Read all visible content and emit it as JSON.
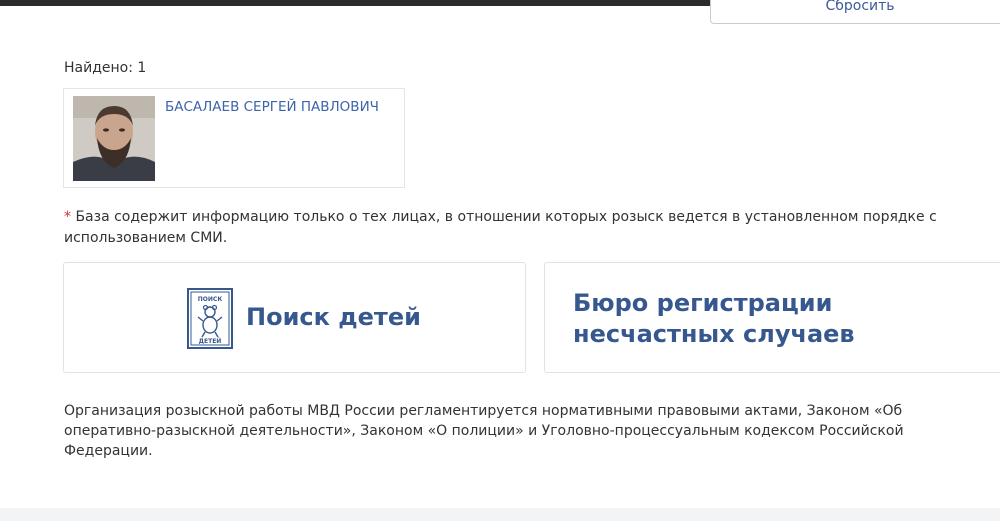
{
  "header": {
    "reset_label": "Сбросить"
  },
  "results": {
    "found_label": "Найдено: 1",
    "items": [
      {
        "name": "БАСАЛАЕВ СЕРГЕЙ ПАВЛОВИЧ"
      }
    ]
  },
  "note": {
    "asterisk": "*",
    "text": "База содержит информацию только о тех лицах, в отношении которых розыск ведется в установленном порядке с использованием СМИ."
  },
  "links": {
    "children": {
      "title": "Поиск детей",
      "logo_top": "ПОИСК",
      "logo_bottom": "ДЕТЕЙ"
    },
    "bureau": {
      "title": "Бюро регистрации несчастных случаев"
    }
  },
  "footer": {
    "text": "Организация розыскной работы МВД России регламентируется нормативными правовыми актами, Законом «Об оперативно-разыскной деятельности», Законом «О полиции» и Уголовно-процессуальным кодексом Российской Федерации."
  },
  "colors": {
    "link_blue": "#3d64ab",
    "card_title_blue": "#37588f",
    "asterisk_red": "#d0312d",
    "text": "#333333"
  },
  "icons": [
    "person-photo",
    "children-search-logo"
  ]
}
